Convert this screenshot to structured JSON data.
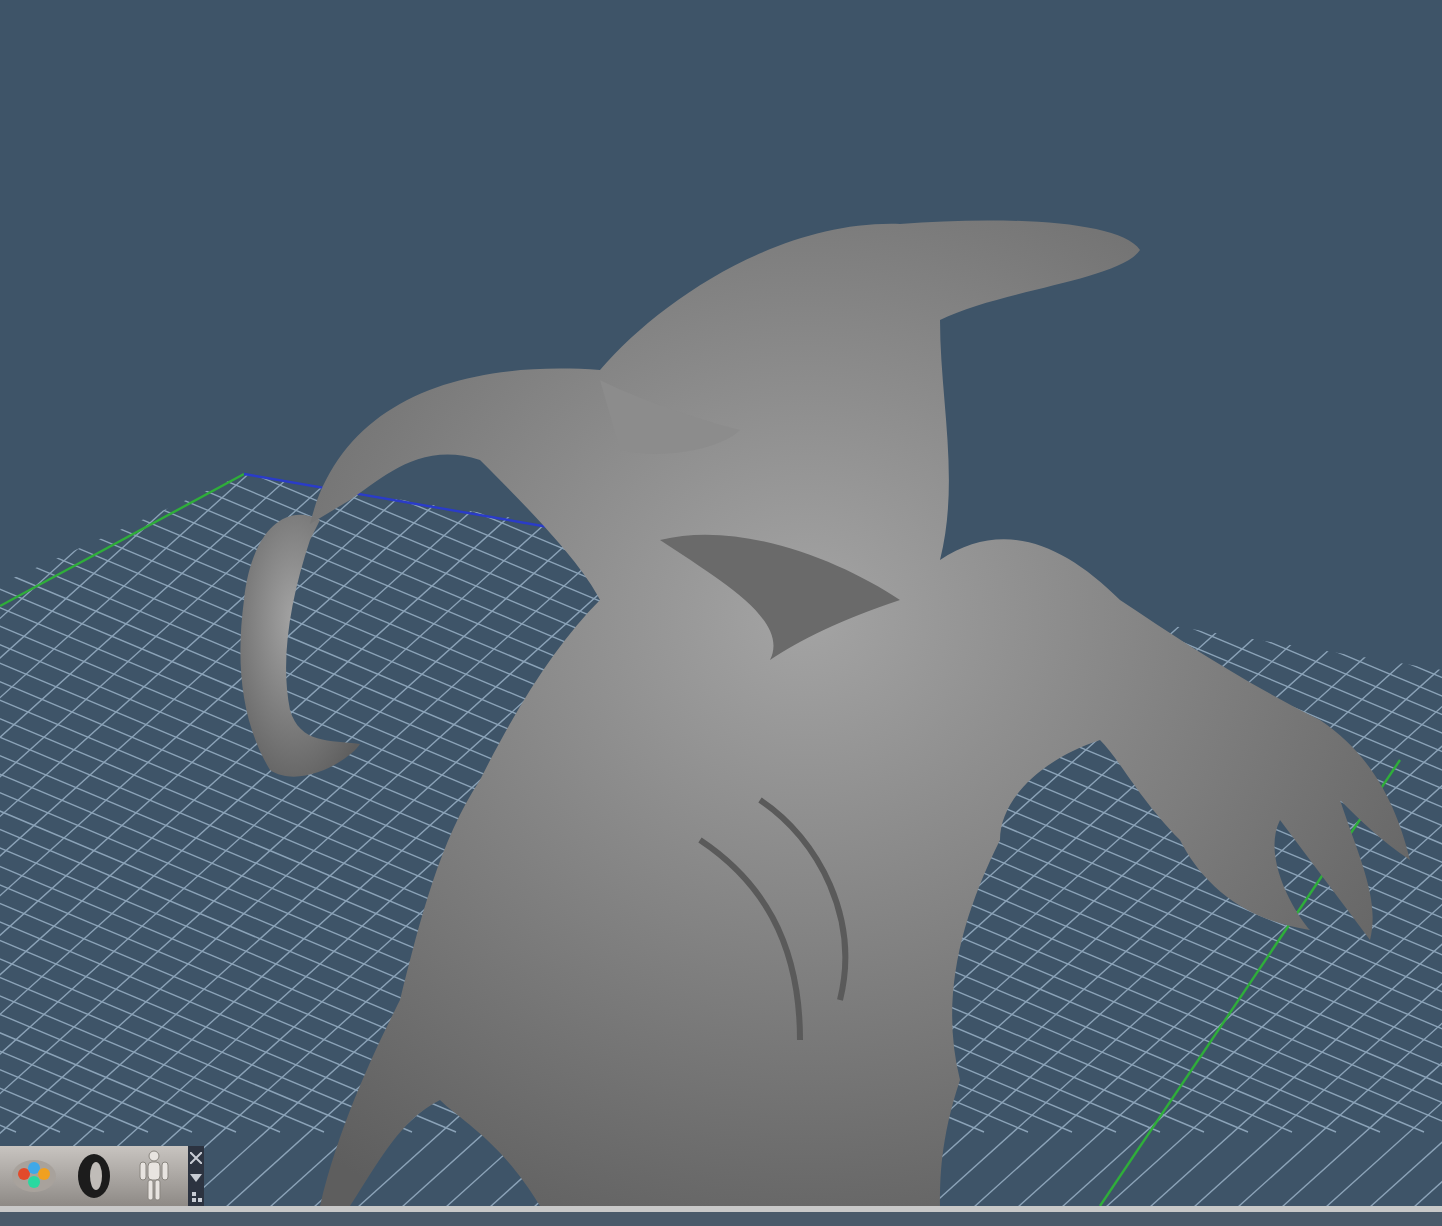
{
  "tray": {
    "tools": [
      {
        "kind": "palette"
      },
      {
        "kind": "ring"
      },
      {
        "kind": "figure"
      }
    ]
  }
}
